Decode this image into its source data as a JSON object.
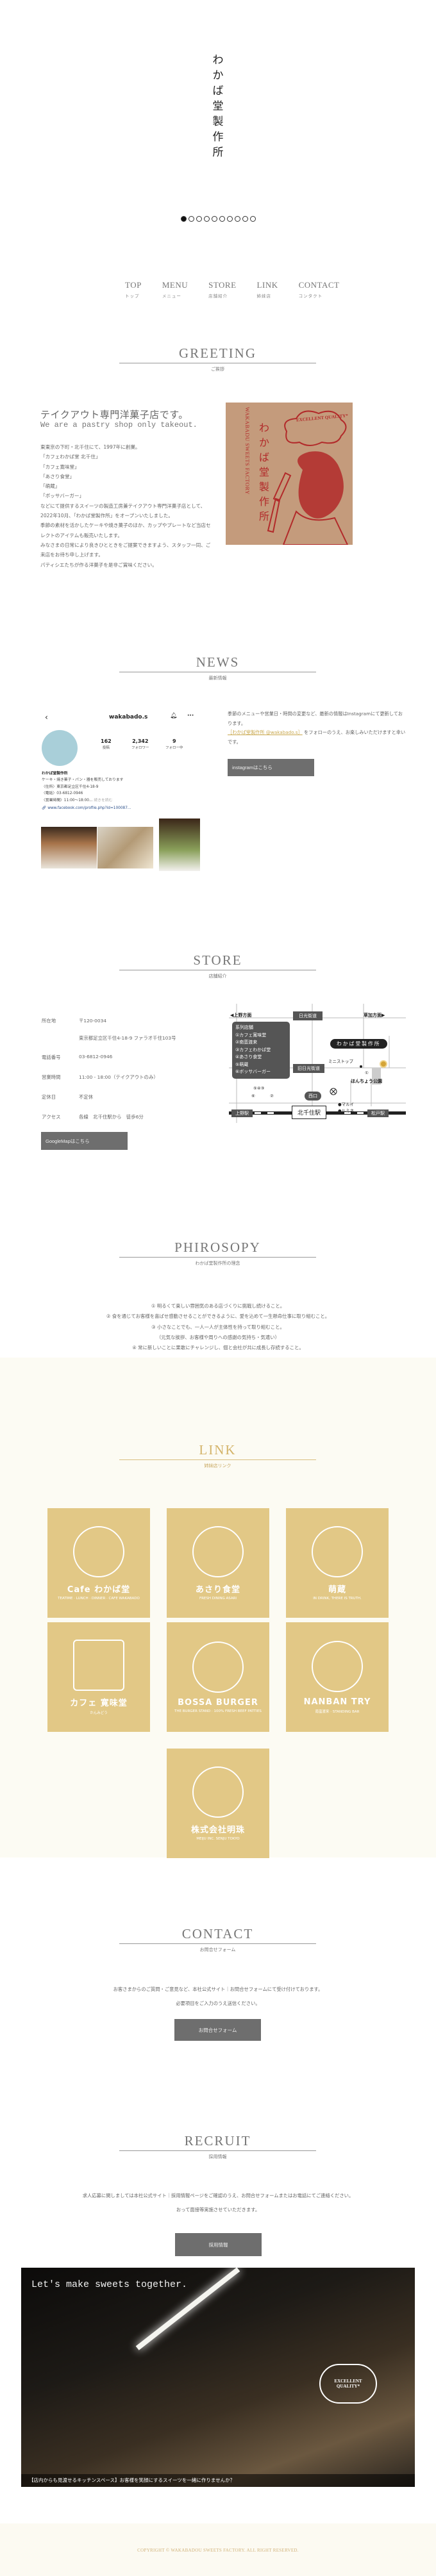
{
  "logo": {
    "chars": [
      "わ",
      "か",
      "ば",
      "堂",
      "製",
      "作",
      "所"
    ]
  },
  "slider": {
    "count": 10,
    "active": 0
  },
  "nav": [
    {
      "en": "TOP",
      "ja": "トップ"
    },
    {
      "en": "MENU",
      "ja": "メニュー"
    },
    {
      "en": "STORE",
      "ja": "店舗紹介"
    },
    {
      "en": "LINK",
      "ja": "姉妹店"
    },
    {
      "en": "CONTACT",
      "ja": "コンタクト"
    }
  ],
  "greeting": {
    "en": "GREETING",
    "ja": "ご挨拶",
    "title": "テイクアウト専門洋菓子店です。",
    "subtitle": "We are a pastry shop only takeout.",
    "body": [
      "東東京の下町・北千住にて、1997年に創業。",
      "「カフェわかば堂 北千住」",
      "「カフェ寛味堂」",
      "「あさり食堂」",
      "「萌蔵」",
      "「ボッサバーガー」",
      "などにて提供するスイーツの製造工房兼テイクアウト専門洋菓子店として、2022年10月、「わかば堂製作所」をオープンいたしました。",
      "季節の素材を活かしたケーキや焼き菓子のほか、カップやプレートなど当店セレクトのアイテムも販売いたします。",
      "みなさまの日常により良きひとときをご提案できますよう、スタッフ一同、ご来店をお待ち申し上げます。",
      "パティシエたちが作る洋菓子を是非ご賞味ください。"
    ],
    "image": {
      "speech": "EXCELLENT QUALITY*",
      "name_ja": "わかば堂製作所",
      "name_en": "WAKABADU SWEETS FACTORY"
    }
  },
  "news": {
    "en": "NEWS",
    "ja": "最新情報",
    "instagram": {
      "username": "wakabado.s",
      "posts": "162",
      "posts_label": "投稿",
      "followers": "2,342",
      "followers_label": "フォロワー",
      "following": "9",
      "following_label": "フォロー中",
      "name": "わかば堂製作所",
      "bio": [
        "ケーキ・焼き菓子・パン・器を販売しております",
        "〈住所〉東京都足立区千住4-18-9",
        "〈電話〉03-6812-0946",
        "〈営業時間〉11:00～18:00..."
      ],
      "more": "続きを読む",
      "link": "www.facebook.com/profile.php?id=100087..."
    },
    "text_before": "季節のメニューや営業日・時間の変更など、最新の情報はInstagramにて更新しております。",
    "link_text": "［わかば堂製作所 @wakabado.s］",
    "text_after": "をフォローのうえ、お楽しみいただけますと幸いです。",
    "button": "instagramはこちら"
  },
  "store": {
    "en": "STORE",
    "ja": "店舗紹介",
    "rows": [
      {
        "k": "所在地",
        "v": "〒120-0034"
      },
      {
        "k": "",
        "v": "東京都足立区千住4-18-9 ファラオ千住103号"
      },
      {
        "k": "電話番号",
        "v": "03-6812-0946"
      },
      {
        "k": "営業時間",
        "v": "11:00 - 18:00（テイクアウトのみ）"
      },
      {
        "k": "定休日",
        "v": "不定休"
      },
      {
        "k": "アクセス",
        "v": "各線　北千住駅から　徒歩6分"
      }
    ],
    "button": "GoogleMapはこちら",
    "map": {
      "ueno_dir": "◀上野方面",
      "nikko": "日光街道",
      "soka_dir": "草加方面▶",
      "chain_title": "系列店舗",
      "chain": [
        "①カフェ寛味堂",
        "②南蛮渡来",
        "③カフェわかば堂",
        "④あさり食堂",
        "⑤萌蔵",
        "⑥ボッサバーガー"
      ],
      "shop": "わかば堂製作所",
      "ministop": "ミニストップ",
      "old_nikko": "旧日光街道",
      "park": "ほんちょう公園",
      "west": "西口",
      "marui": "●マルイ",
      "lumine": "●ルミネ",
      "ueno_st": "上野駅",
      "station": "北千住駅",
      "matsudo": "松戸駅",
      "nums_a": "⑤④③",
      "nums_b": "⑥",
      "nums_c": "②",
      "nums_d": "①"
    }
  },
  "philosophy": {
    "en": "PHIROSOPY",
    "ja": "わかば堂製作所の理念",
    "lines": [
      "① 明るくて楽しい雰囲気のある店づくりに挑戦し続けること。",
      "② 食を通じてお客様を喜ばせ感動させることができるように、愛を込めて一生懸命仕事に取り組むこと。",
      "③ 小さなことでも、一人一人が主体性を持って取り組むこと。",
      "（元気な挨拶、お客様や周りへの感謝の気持ち・気遣い）",
      "④ 常に新しいことに果敢にチャレンジし、個と会社が共に成長し存続すること。"
    ]
  },
  "link": {
    "en": "LINK",
    "ja": "姉妹店リンク",
    "tiles": [
      {
        "name": "Cafe わかば堂",
        "sub": "TEATIME · LUNCH · DINNER · CAFE WAKABADO"
      },
      {
        "name": "あさり食堂",
        "sub": "FRESH DINING ASARI"
      },
      {
        "name": "萌蔵",
        "sub": "IN DRINK, THERE IS TRUTH."
      },
      {
        "name": "カフェ 寛味堂",
        "sub": "かんみどう"
      },
      {
        "name": "BOSSA BURGER",
        "sub": "THE BURGER STAND · 100% FRESH BEEF PATTIES"
      },
      {
        "name": "NANBAN TRY",
        "sub": "南蛮渡来 · STANDING BAR"
      },
      {
        "name": "株式会社明珠",
        "sub": "MEIJU INC. SENJU TOKYO"
      }
    ],
    "colors": {
      "tile": "#e2c886",
      "bg": "#fcfbf3"
    }
  },
  "contact": {
    "en": "CONTACT",
    "ja": "お問合せフォーム",
    "lines": [
      "お客さまからのご質問・ご意見など、本社公式サイト｜お問合せフォームにて受け付けております。",
      "必要項目をご入力のうえ送信ください。"
    ],
    "button": "お問合せフォーム"
  },
  "recruit": {
    "en": "RECRUIT",
    "ja": "採用情報",
    "lines": [
      "求人応募に関しましては本社公式サイト｜採用情報ページをご確認のうえ、お問合せフォームまたはお電話にてご連絡ください。",
      "おって面接等実施させていただきます。"
    ],
    "button": "採用情報"
  },
  "banner": {
    "headline": "Let's make sweets together.",
    "speech": "EXCELLENT QUALITY*",
    "caption": "【店内からも見渡せるキッチンスペース】お客様を笑顔にするスイーツを一緒に作りませんか？"
  },
  "footer": {
    "copyright": "COPYRIGHT © WAKABADOU SWEETS FACTORY. ALL RIGHT RESERVED."
  }
}
